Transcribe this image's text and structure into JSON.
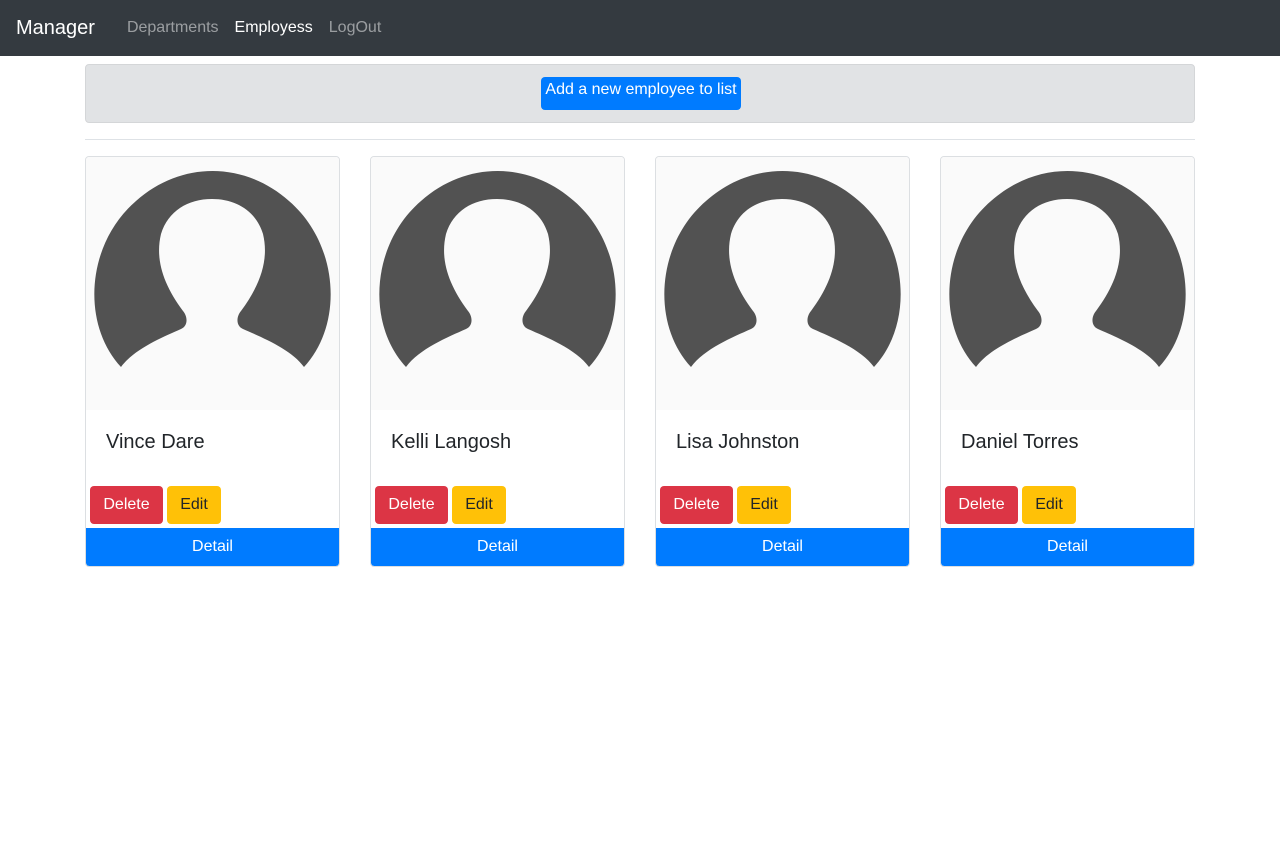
{
  "navbar": {
    "brand": "Manager",
    "links": [
      {
        "label": "Departments",
        "active": false
      },
      {
        "label": "Employess",
        "active": true
      },
      {
        "label": "LogOut",
        "active": false
      }
    ]
  },
  "header": {
    "add_button_label": "Add a new employee to list"
  },
  "employees": [
    {
      "name": "Vince Dare",
      "delete_label": "Delete",
      "edit_label": "Edit",
      "detail_label": "Detail",
      "avatar_icon": "person-placeholder-icon"
    },
    {
      "name": "Kelli Langosh",
      "delete_label": "Delete",
      "edit_label": "Edit",
      "detail_label": "Detail",
      "avatar_icon": "person-placeholder-icon"
    },
    {
      "name": "Lisa Johnston",
      "delete_label": "Delete",
      "edit_label": "Edit",
      "detail_label": "Detail",
      "avatar_icon": "person-placeholder-icon"
    },
    {
      "name": "Daniel Torres",
      "delete_label": "Delete",
      "edit_label": "Edit",
      "detail_label": "Detail",
      "avatar_icon": "person-placeholder-icon"
    }
  ],
  "colors": {
    "navbar_bg": "#343a40",
    "primary": "#007bff",
    "danger": "#dc3545",
    "warning": "#ffc107",
    "avatar": "#525252"
  }
}
